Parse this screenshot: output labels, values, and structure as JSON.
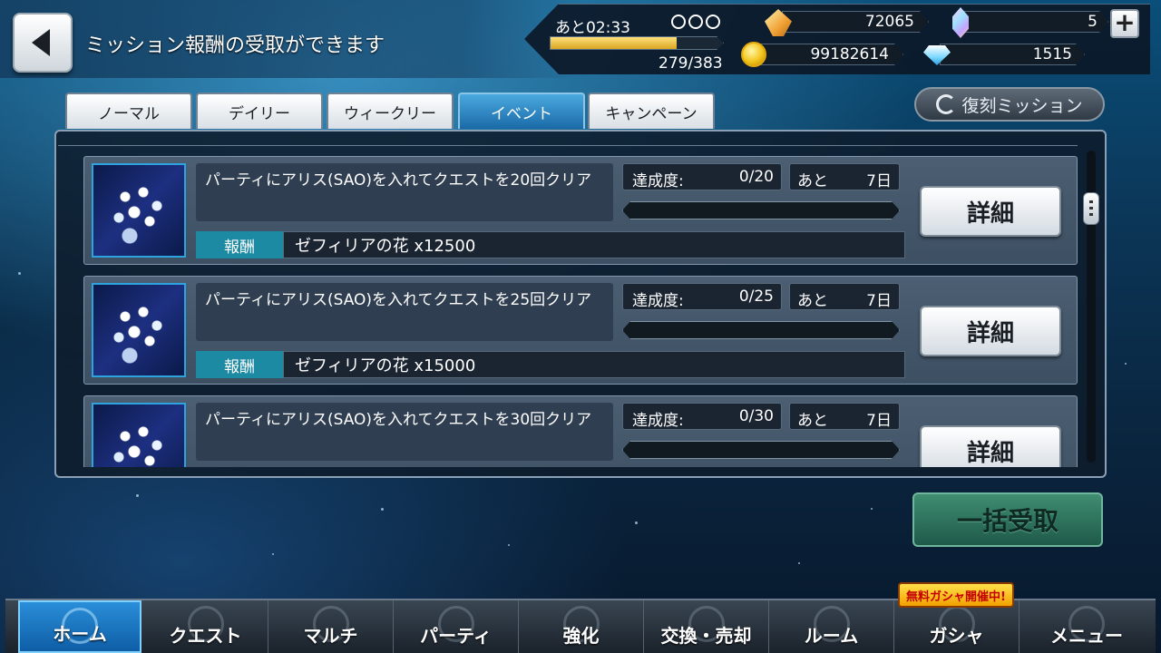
{
  "header": {
    "title": "ミッション報酬の受取ができます"
  },
  "status": {
    "time_left": "あと02:33",
    "stamina": "279/383",
    "stamina_fraction": 0.73,
    "crystal": "72065",
    "gem": "5",
    "coin": "99182614",
    "diamond": "1515"
  },
  "tabs": [
    {
      "label": "ノーマル"
    },
    {
      "label": "デイリー"
    },
    {
      "label": "ウィークリー"
    },
    {
      "label": "イベント"
    },
    {
      "label": "キャンペーン"
    }
  ],
  "reissue_button": "復刻ミッション",
  "missions": [
    {
      "title": "パーティにアリス(SAO)を入れてクエストを20回クリア",
      "progress_label": "達成度:",
      "progress": "0/20",
      "progress_fraction": 0,
      "deadline_label": "あと",
      "deadline": "7日",
      "reward_label": "報酬",
      "reward": "ゼフィリアの花 x12500",
      "detail_label": "詳細"
    },
    {
      "title": "パーティにアリス(SAO)を入れてクエストを25回クリア",
      "progress_label": "達成度:",
      "progress": "0/25",
      "progress_fraction": 0,
      "deadline_label": "あと",
      "deadline": "7日",
      "reward_label": "報酬",
      "reward": "ゼフィリアの花 x15000",
      "detail_label": "詳細"
    },
    {
      "title": "パーティにアリス(SAO)を入れてクエストを30回クリア",
      "progress_label": "達成度:",
      "progress": "0/30",
      "progress_fraction": 0,
      "deadline_label": "あと",
      "deadline": "7日",
      "reward_label": "報酬",
      "reward": "",
      "detail_label": "詳細"
    }
  ],
  "bulk_receive": "一括受取",
  "free_gacha_badge": "無料ガシャ開催中!",
  "nav": [
    {
      "label": "ホーム"
    },
    {
      "label": "クエスト"
    },
    {
      "label": "マルチ"
    },
    {
      "label": "パーティ"
    },
    {
      "label": "強化"
    },
    {
      "label": "交換・売却"
    },
    {
      "label": "ルーム"
    },
    {
      "label": "ガシャ"
    },
    {
      "label": "メニュー"
    }
  ],
  "colors": {
    "active_tab": "#1a6aa8",
    "reward_label_bg": "#1c8aa3",
    "bulk_receive_bg": "#2f7560",
    "nav_active": "#0e5ea6"
  }
}
